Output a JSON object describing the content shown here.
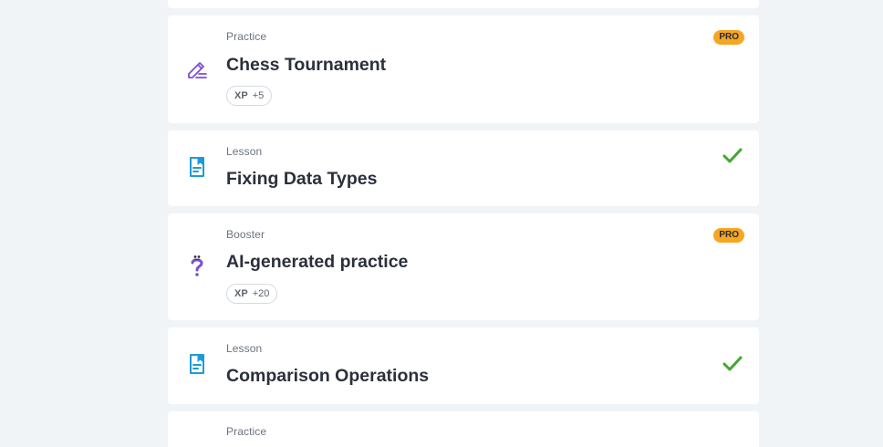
{
  "items": [
    {
      "type": "Practice",
      "title": "Chess Tournament",
      "icon": "pencil-icon",
      "xp_label": "XP",
      "xp_value": "+5",
      "badge": "PRO"
    },
    {
      "type": "Lesson",
      "title": "Fixing Data Types",
      "icon": "document-bookmark-icon",
      "completed": true
    },
    {
      "type": "Booster",
      "title": "AI-generated practice",
      "icon": "question-mark-icon",
      "xp_label": "XP",
      "xp_value": "+20",
      "badge": "PRO"
    },
    {
      "type": "Lesson",
      "title": "Comparison Operations",
      "icon": "document-bookmark-icon",
      "completed": true
    },
    {
      "type": "Practice"
    }
  ],
  "colors": {
    "background": "#f1f4f7",
    "pro_badge": "#f5a623",
    "check": "#3fa82c",
    "lesson_icon": "#1e9bd7",
    "practice_icon": "#7b4fd6"
  }
}
